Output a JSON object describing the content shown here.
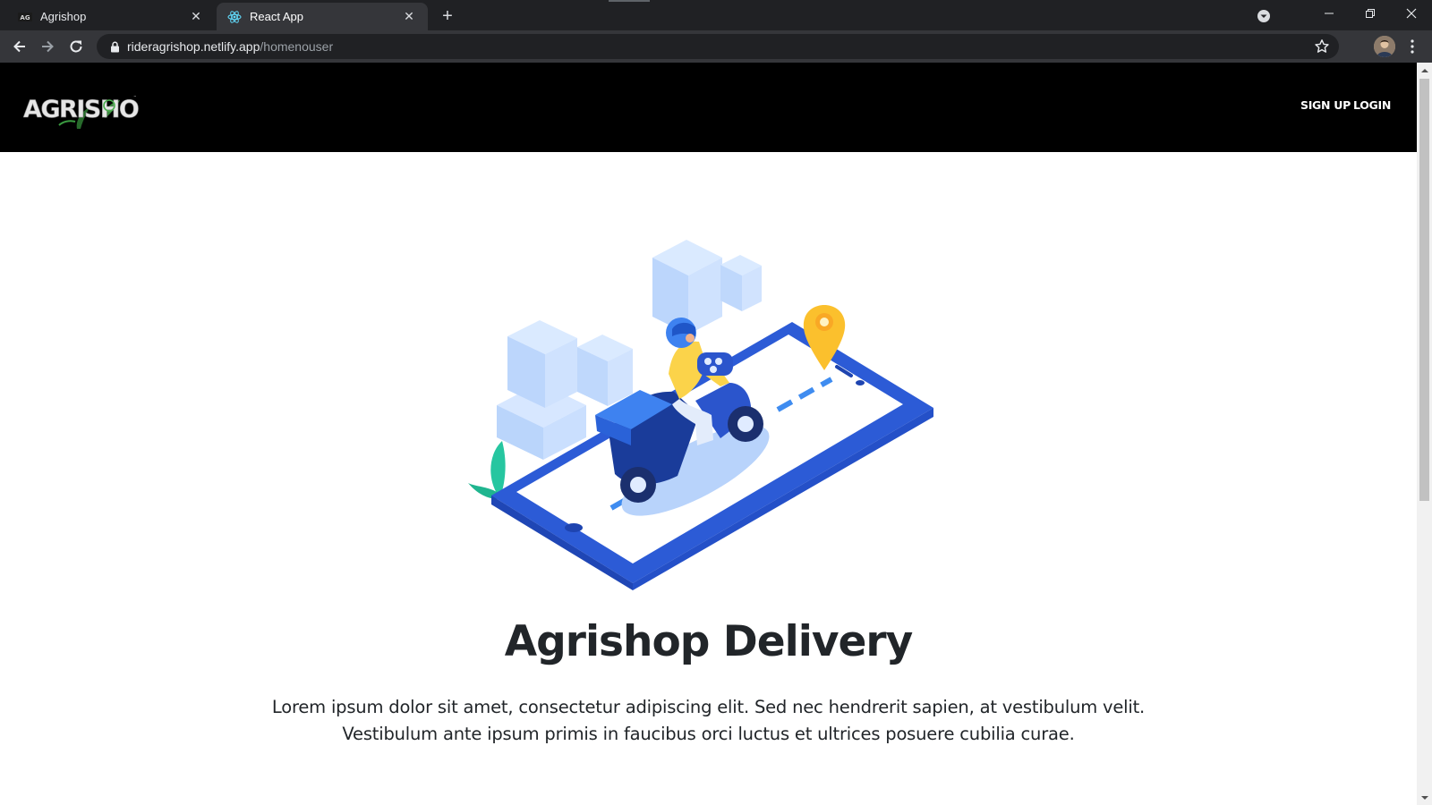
{
  "browser": {
    "tabs": [
      {
        "title": "Agrishop",
        "active": false
      },
      {
        "title": "React App",
        "active": true
      }
    ],
    "url": {
      "host": "rideragrishop.netlify.app",
      "path": "/homenouser"
    }
  },
  "site": {
    "logo_text": "AGRISHOP",
    "nav": {
      "signup": "SIGN UP",
      "login": "LOGIN"
    }
  },
  "hero": {
    "title": "Agrishop Delivery",
    "lines": [
      "Lorem ipsum dolor sit amet, consectetur adipiscing elit. Sed nec hendrerit sapien, at vestibulum velit.",
      "Vestibulum ante ipsum primis in faucibus orci luctus et ultrices posuere cubilia curae."
    ]
  },
  "colors": {
    "header_bg": "#000000",
    "text": "#212529",
    "illustration_blue": "#2f5fdc",
    "pin_yellow": "#fbc02d"
  }
}
